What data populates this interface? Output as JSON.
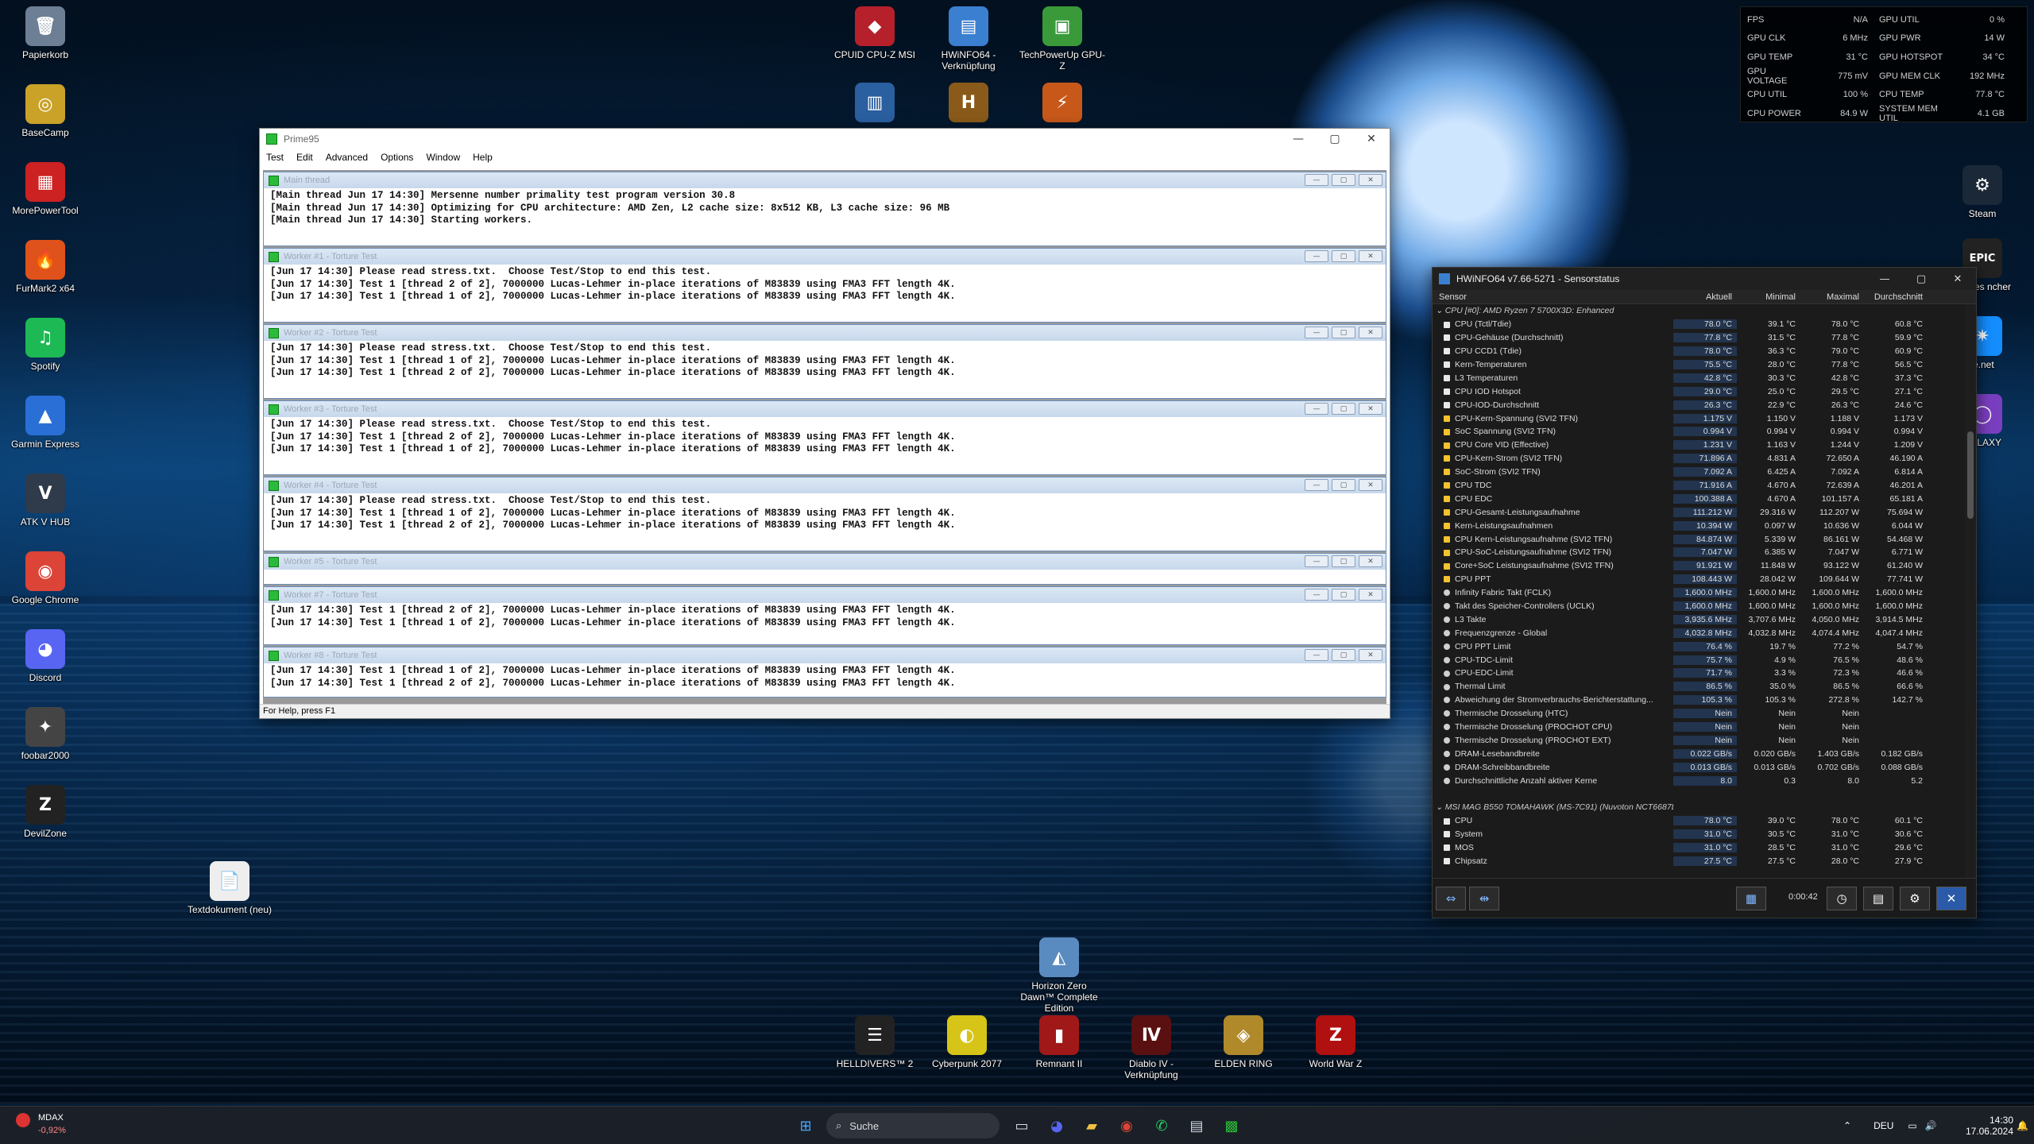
{
  "desktop": {
    "left_icons": [
      {
        "label": "Papierkorb",
        "icon": "recycle-bin-icon",
        "glyph": "🗑",
        "color": "#6c7f94"
      },
      {
        "label": "BaseCamp",
        "icon": "basecamp-icon",
        "glyph": "◎",
        "color": "#c9a227"
      },
      {
        "label": "MorePowerTool",
        "icon": "morepowertool-icon",
        "glyph": "▦",
        "color": "#c22"
      },
      {
        "label": "FurMark2 x64",
        "icon": "furmark-icon",
        "glyph": "🔥",
        "color": "#e0521b"
      },
      {
        "label": "Spotify",
        "icon": "spotify-icon",
        "glyph": "♫",
        "color": "#1db954"
      },
      {
        "label": "Garmin Express",
        "icon": "garmin-icon",
        "glyph": "▲",
        "color": "#2a6fd6"
      },
      {
        "label": "ATK V HUB",
        "icon": "atk-icon",
        "glyph": "V",
        "color": "#2f3a4a"
      },
      {
        "label": "Google Chrome",
        "icon": "chrome-icon",
        "glyph": "◉",
        "color": "#db4437"
      },
      {
        "label": "Discord",
        "icon": "discord-icon",
        "glyph": "◕",
        "color": "#5865f2"
      },
      {
        "label": "foobar2000",
        "icon": "foobar-icon",
        "glyph": "✦",
        "color": "#444"
      },
      {
        "label": "DevilZone",
        "icon": "devilzone-icon",
        "glyph": "Z",
        "color": "#222"
      }
    ],
    "top_icons": [
      {
        "label": "CPUID CPU-Z MSI",
        "icon": "cpuz-icon",
        "glyph": "◆",
        "color": "#b5202a"
      },
      {
        "label": "HWiNFO64 - Verknüpfung",
        "icon": "hwinfo-icon",
        "glyph": "▤",
        "color": "#3b7fd0"
      },
      {
        "label": "TechPowerUp GPU-Z",
        "icon": "gpuz-icon",
        "glyph": "▣",
        "color": "#3a9a3a"
      }
    ],
    "top_icons_row2": [
      {
        "icon": "app-icon-1",
        "glyph": "▥",
        "color": "#2a5fa0"
      },
      {
        "icon": "hearthstone-icon",
        "glyph": "H",
        "color": "#8a5a1a"
      },
      {
        "icon": "app-icon-3",
        "glyph": "⚡",
        "color": "#c8581a"
      }
    ],
    "right_icons": [
      {
        "label": "Steam",
        "icon": "steam-icon",
        "glyph": "⚙",
        "color": "#1b2838"
      },
      {
        "label": "Games\nncher",
        "icon": "epic-games-icon",
        "glyph": "EPIC",
        "color": "#222"
      },
      {
        "label": "le.net",
        "icon": "battlenet-icon",
        "glyph": "✷",
        "color": "#148eff"
      },
      {
        "label": "GALAXY",
        "icon": "gog-galaxy-icon",
        "glyph": "◯",
        "color": "#7a3fc0"
      }
    ],
    "mid_icons": [
      {
        "label": "Textdokument (neu)",
        "icon": "text-document-icon",
        "glyph": "📄",
        "color": "#eee"
      },
      {
        "label": "Horizon Zero Dawn™ Complete Edition",
        "icon": "horizon-icon",
        "glyph": "◭",
        "color": "#5a8bc0"
      }
    ],
    "game_icons": [
      {
        "label": "HELLDIVERS™ 2",
        "icon": "helldivers-icon",
        "glyph": "☰",
        "color": "#222"
      },
      {
        "label": "Cyberpunk 2077",
        "icon": "cyberpunk-icon",
        "glyph": "◐",
        "color": "#d6c518"
      },
      {
        "label": "Remnant II",
        "icon": "remnant-icon",
        "glyph": "▮",
        "color": "#a01818"
      },
      {
        "label": "Diablo IV - Verknüpfung",
        "icon": "diablo-icon",
        "glyph": "Ⅳ",
        "color": "#5a1010"
      },
      {
        "label": "ELDEN RING",
        "icon": "elden-ring-icon",
        "glyph": "◈",
        "color": "#b08a2a"
      },
      {
        "label": "World War Z",
        "icon": "world-war-z-icon",
        "glyph": "Z",
        "color": "#b01010"
      }
    ]
  },
  "osd": {
    "rows": [
      [
        "FPS",
        "N/A",
        "GPU UTIL",
        "0 %"
      ],
      [
        "GPU CLK",
        "6 MHz",
        "GPU PWR",
        "14 W"
      ],
      [
        "GPU TEMP",
        "31 °C",
        "GPU HOTSPOT",
        "34 °C"
      ],
      [
        "GPU VOLTAGE",
        "775 mV",
        "GPU MEM CLK",
        "192 MHz"
      ],
      [
        "CPU UTIL",
        "100 %",
        "CPU TEMP",
        "77.8 °C"
      ],
      [
        "CPU POWER",
        "84.9 W",
        "SYSTEM MEM UTIL",
        "4.1 GB"
      ]
    ]
  },
  "prime95": {
    "title": "Prime95",
    "menu": [
      "Test",
      "Edit",
      "Advanced",
      "Options",
      "Window",
      "Help"
    ],
    "status": "For Help, press F1",
    "children": [
      {
        "title": "Main thread",
        "lines": [
          "[Main thread Jun 17 14:30] Mersenne number primality test program version 30.8",
          "[Main thread Jun 17 14:30] Optimizing for CPU architecture: AMD Zen, L2 cache size: 8x512 KB, L3 cache size: 96 MB",
          "[Main thread Jun 17 14:30] Starting workers."
        ]
      },
      {
        "title": "Worker #1 - Torture Test",
        "lines": [
          "[Jun 17 14:30] Please read stress.txt.  Choose Test/Stop to end this test.",
          "[Jun 17 14:30] Test 1 [thread 2 of 2], 7000000 Lucas-Lehmer in-place iterations of M83839 using FMA3 FFT length 4K.",
          "[Jun 17 14:30] Test 1 [thread 1 of 2], 7000000 Lucas-Lehmer in-place iterations of M83839 using FMA3 FFT length 4K."
        ]
      },
      {
        "title": "Worker #2 - Torture Test",
        "lines": [
          "[Jun 17 14:30] Please read stress.txt.  Choose Test/Stop to end this test.",
          "[Jun 17 14:30] Test 1 [thread 1 of 2], 7000000 Lucas-Lehmer in-place iterations of M83839 using FMA3 FFT length 4K.",
          "[Jun 17 14:30] Test 1 [thread 2 of 2], 7000000 Lucas-Lehmer in-place iterations of M83839 using FMA3 FFT length 4K."
        ]
      },
      {
        "title": "Worker #3 - Torture Test",
        "lines": [
          "[Jun 17 14:30] Please read stress.txt.  Choose Test/Stop to end this test.",
          "[Jun 17 14:30] Test 1 [thread 2 of 2], 7000000 Lucas-Lehmer in-place iterations of M83839 using FMA3 FFT length 4K.",
          "[Jun 17 14:30] Test 1 [thread 1 of 2], 7000000 Lucas-Lehmer in-place iterations of M83839 using FMA3 FFT length 4K."
        ]
      },
      {
        "title": "Worker #4 - Torture Test",
        "lines": [
          "[Jun 17 14:30] Please read stress.txt.  Choose Test/Stop to end this test.",
          "[Jun 17 14:30] Test 1 [thread 1 of 2], 7000000 Lucas-Lehmer in-place iterations of M83839 using FMA3 FFT length 4K.",
          "[Jun 17 14:30] Test 1 [thread 2 of 2], 7000000 Lucas-Lehmer in-place iterations of M83839 using FMA3 FFT length 4K."
        ]
      },
      {
        "title": "Worker #5 - Torture Test",
        "lines": []
      },
      {
        "title": "Worker #7 - Torture Test",
        "lines": [
          "[Jun 17 14:30] Test 1 [thread 2 of 2], 7000000 Lucas-Lehmer in-place iterations of M83839 using FMA3 FFT length 4K.",
          "[Jun 17 14:30] Test 1 [thread 1 of 2], 7000000 Lucas-Lehmer in-place iterations of M83839 using FMA3 FFT length 4K."
        ]
      },
      {
        "title": "Worker #8 - Torture Test",
        "lines": [
          "[Jun 17 14:30] Test 1 [thread 1 of 2], 7000000 Lucas-Lehmer in-place iterations of M83839 using FMA3 FFT length 4K.",
          "[Jun 17 14:30] Test 1 [thread 2 of 2], 7000000 Lucas-Lehmer in-place iterations of M83839 using FMA3 FFT length 4K."
        ]
      }
    ]
  },
  "hwinfo": {
    "title": "HWiNFO64 v7.66-5271 - Sensorstatus",
    "columns": [
      "Sensor",
      "Aktuell",
      "Minimal",
      "Maximal",
      "Durchschnitt"
    ],
    "elapsed": "0:00:42",
    "rows": [
      {
        "g": true,
        "n": "CPU [#0]: AMD Ryzen 7 5700X3D: Enhanced"
      },
      {
        "n": "CPU (Tctl/Tdie)",
        "t": "temp",
        "v": [
          "78.0 °C",
          "39.1 °C",
          "78.0 °C",
          "60.8 °C"
        ]
      },
      {
        "n": "CPU-Gehäuse (Durchschnitt)",
        "t": "temp",
        "v": [
          "77.8 °C",
          "31.5 °C",
          "77.8 °C",
          "59.9 °C"
        ]
      },
      {
        "n": "CPU CCD1 (Tdie)",
        "t": "temp",
        "v": [
          "78.0 °C",
          "36.3 °C",
          "79.0 °C",
          "60.9 °C"
        ]
      },
      {
        "n": "Kern-Temperaturen",
        "t": "temp",
        "v": [
          "75.5 °C",
          "28.0 °C",
          "77.8 °C",
          "56.5 °C"
        ]
      },
      {
        "n": "L3 Temperaturen",
        "t": "temp",
        "v": [
          "42.8 °C",
          "30.3 °C",
          "42.8 °C",
          "37.3 °C"
        ]
      },
      {
        "n": "CPU IOD Hotspot",
        "t": "temp",
        "v": [
          "29.0 °C",
          "25.0 °C",
          "29.5 °C",
          "27.1 °C"
        ]
      },
      {
        "n": "CPU-IOD-Durchschnitt",
        "t": "temp",
        "v": [
          "26.3 °C",
          "22.9 °C",
          "26.3 °C",
          "24.6 °C"
        ]
      },
      {
        "n": "CPU-Kern-Spannung (SVI2 TFN)",
        "t": "volt",
        "v": [
          "1.175 V",
          "1.150 V",
          "1.188 V",
          "1.173 V"
        ]
      },
      {
        "n": "SoC Spannung (SVI2 TFN)",
        "t": "volt",
        "v": [
          "0.994 V",
          "0.994 V",
          "0.994 V",
          "0.994 V"
        ]
      },
      {
        "n": "CPU Core VID (Effective)",
        "t": "volt",
        "v": [
          "1.231 V",
          "1.163 V",
          "1.244 V",
          "1.209 V"
        ]
      },
      {
        "n": "CPU-Kern-Strom (SVI2 TFN)",
        "t": "volt",
        "v": [
          "71.896 A",
          "4.831 A",
          "72.650 A",
          "46.190 A"
        ]
      },
      {
        "n": "SoC-Strom (SVI2 TFN)",
        "t": "volt",
        "v": [
          "7.092 A",
          "6.425 A",
          "7.092 A",
          "6.814 A"
        ]
      },
      {
        "n": "CPU TDC",
        "t": "volt",
        "v": [
          "71.916 A",
          "4.670 A",
          "72.639 A",
          "46.201 A"
        ]
      },
      {
        "n": "CPU EDC",
        "t": "volt",
        "v": [
          "100.388 A",
          "4.670 A",
          "101.157 A",
          "65.181 A"
        ]
      },
      {
        "n": "CPU-Gesamt-Leistungsaufnahme",
        "t": "volt",
        "v": [
          "111.212 W",
          "29.316 W",
          "112.207 W",
          "75.694 W"
        ]
      },
      {
        "n": "Kern-Leistungsaufnahmen",
        "t": "volt",
        "v": [
          "10.394 W",
          "0.097 W",
          "10.636 W",
          "6.044 W"
        ]
      },
      {
        "n": "CPU Kern-Leistungsaufnahme (SVI2 TFN)",
        "t": "volt",
        "v": [
          "84.874 W",
          "5.339 W",
          "86.161 W",
          "54.468 W"
        ]
      },
      {
        "n": "CPU-SoC-Leistungsaufnahme (SVI2 TFN)",
        "t": "volt",
        "v": [
          "7.047 W",
          "6.385 W",
          "7.047 W",
          "6.771 W"
        ]
      },
      {
        "n": "Core+SoC Leistungsaufnahme (SVI2 TFN)",
        "t": "volt",
        "v": [
          "91.921 W",
          "11.848 W",
          "93.122 W",
          "61.240 W"
        ]
      },
      {
        "n": "CPU PPT",
        "t": "volt",
        "v": [
          "108.443 W",
          "28.042 W",
          "109.644 W",
          "77.741 W"
        ]
      },
      {
        "n": "Infinity Fabric Takt (FCLK)",
        "t": "clock",
        "v": [
          "1,600.0 MHz",
          "1,600.0 MHz",
          "1,600.0 MHz",
          "1,600.0 MHz"
        ]
      },
      {
        "n": "Takt des Speicher-Controllers (UCLK)",
        "t": "clock",
        "v": [
          "1,600.0 MHz",
          "1,600.0 MHz",
          "1,600.0 MHz",
          "1,600.0 MHz"
        ]
      },
      {
        "n": "L3 Takte",
        "t": "clock",
        "v": [
          "3,935.6 MHz",
          "3,707.6 MHz",
          "4,050.0 MHz",
          "3,914.5 MHz"
        ]
      },
      {
        "n": "Frequenzgrenze - Global",
        "t": "clock",
        "v": [
          "4,032.8 MHz",
          "4,032.8 MHz",
          "4,074.4 MHz",
          "4,047.4 MHz"
        ]
      },
      {
        "n": "CPU PPT Limit",
        "t": "clock",
        "v": [
          "76.4 %",
          "19.7 %",
          "77.2 %",
          "54.7 %"
        ]
      },
      {
        "n": "CPU-TDC-Limit",
        "t": "clock",
        "v": [
          "75.7 %",
          "4.9 %",
          "76.5 %",
          "48.6 %"
        ]
      },
      {
        "n": "CPU-EDC-Limit",
        "t": "clock",
        "v": [
          "71.7 %",
          "3.3 %",
          "72.3 %",
          "46.6 %"
        ]
      },
      {
        "n": "Thermal Limit",
        "t": "clock",
        "v": [
          "86.5 %",
          "35.0 %",
          "86.5 %",
          "66.6 %"
        ]
      },
      {
        "n": "Abweichung der Stromverbrauchs-Berichterstattung...",
        "t": "clock",
        "v": [
          "105.3 %",
          "105.3 %",
          "272.8 %",
          "142.7 %"
        ]
      },
      {
        "n": "Thermische Drosselung (HTC)",
        "t": "clock",
        "v": [
          "Nein",
          "Nein",
          "Nein",
          ""
        ]
      },
      {
        "n": "Thermische Drosselung (PROCHOT CPU)",
        "t": "clock",
        "v": [
          "Nein",
          "Nein",
          "Nein",
          ""
        ]
      },
      {
        "n": "Thermische Drosselung (PROCHOT EXT)",
        "t": "clock",
        "v": [
          "Nein",
          "Nein",
          "Nein",
          ""
        ]
      },
      {
        "n": "DRAM-Lesebandbreite",
        "t": "clock",
        "v": [
          "0.022 GB/s",
          "0.020 GB/s",
          "1.403 GB/s",
          "0.182 GB/s"
        ]
      },
      {
        "n": "DRAM-Schreibbandbreite",
        "t": "clock",
        "v": [
          "0.013 GB/s",
          "0.013 GB/s",
          "0.702 GB/s",
          "0.088 GB/s"
        ]
      },
      {
        "n": "Durchschnittliche Anzahl aktiver Kerne",
        "t": "clock",
        "v": [
          "8.0",
          "0.3",
          "8.0",
          "5.2"
        ]
      },
      {
        "blank": true
      },
      {
        "g": true,
        "n": "MSI MAG B550 TOMAHAWK (MS-7C91) (Nuvoton NCT6687D)"
      },
      {
        "n": "CPU",
        "t": "temp",
        "v": [
          "78.0 °C",
          "39.0 °C",
          "78.0 °C",
          "60.1 °C"
        ]
      },
      {
        "n": "System",
        "t": "temp",
        "v": [
          "31.0 °C",
          "30.5 °C",
          "31.0 °C",
          "30.6 °C"
        ]
      },
      {
        "n": "MOS",
        "t": "temp",
        "v": [
          "31.0 °C",
          "28.5 °C",
          "31.0 °C",
          "29.6 °C"
        ]
      },
      {
        "n": "Chipsatz",
        "t": "temp",
        "v": [
          "27.5 °C",
          "27.5 °C",
          "28.0 °C",
          "27.9 °C"
        ]
      }
    ]
  },
  "taskbar": {
    "widget_label": "MDAX",
    "widget_value": "-0,92%",
    "search_placeholder": "Suche",
    "language": "DEU",
    "time": "14:30",
    "date": "17.06.2024",
    "apps": [
      {
        "icon": "start-icon",
        "glyph": "⊞",
        "color": "#4aa8ff"
      },
      {
        "icon": "task-view-icon",
        "glyph": "▭",
        "color": "#ddd"
      },
      {
        "icon": "discord-icon",
        "glyph": "◕",
        "color": "#5865f2"
      },
      {
        "icon": "file-explorer-icon",
        "glyph": "▰",
        "color": "#f0c040"
      },
      {
        "icon": "chrome-icon",
        "glyph": "◉",
        "color": "#db4437"
      },
      {
        "icon": "whatsapp-icon",
        "glyph": "✆",
        "color": "#25d366"
      },
      {
        "icon": "hwinfo-taskbar-icon",
        "glyph": "▤",
        "color": "#cfd8e3"
      },
      {
        "icon": "prime95-taskbar-icon",
        "glyph": "▩",
        "color": "#2bbb3a"
      }
    ]
  }
}
